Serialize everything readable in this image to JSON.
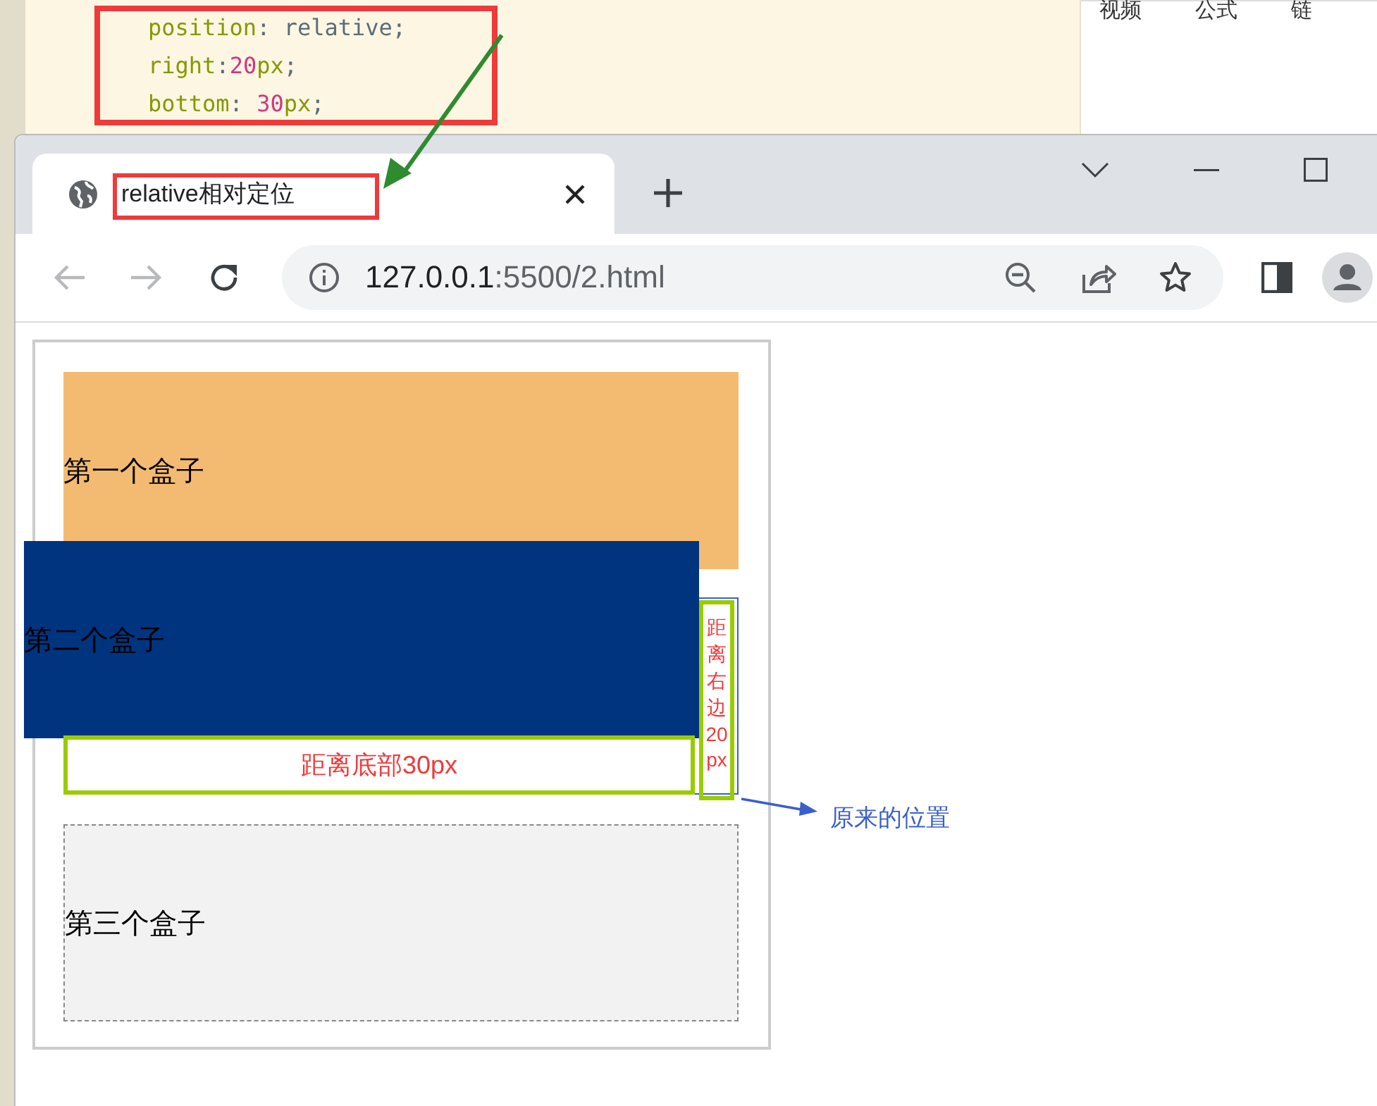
{
  "editor": {
    "code_lines": [
      [
        {
          "text": "position",
          "kind": "property"
        },
        {
          "text": ": ",
          "kind": "punct"
        },
        {
          "text": "relative",
          "kind": "value"
        },
        {
          "text": ";",
          "kind": "punct"
        }
      ],
      [
        {
          "text": "right",
          "kind": "property"
        },
        {
          "text": ":",
          "kind": "punct"
        },
        {
          "text": "20",
          "kind": "number"
        },
        {
          "text": "px",
          "kind": "unit"
        },
        {
          "text": ";",
          "kind": "punct"
        }
      ],
      [
        {
          "text": "bottom",
          "kind": "property"
        },
        {
          "text": ": ",
          "kind": "punct"
        },
        {
          "text": "30",
          "kind": "number"
        },
        {
          "text": "px",
          "kind": "unit"
        },
        {
          "text": ";",
          "kind": "punct"
        }
      ]
    ]
  },
  "side_panel": {
    "tabs": [
      "视频",
      "公式",
      "链"
    ]
  },
  "browser": {
    "tab": {
      "title": "relative相对定位",
      "selected": true
    },
    "address": {
      "host": "127.0.0.1",
      "path": ":5500/2.html"
    }
  },
  "page": {
    "boxes": [
      {
        "label": "第一个盒子",
        "kind": "plain"
      },
      {
        "label": "第二个盒子",
        "kind": "offset"
      },
      {
        "label": "第三个盒子",
        "kind": "dashed"
      }
    ]
  },
  "annotations": {
    "bottom_label": "距离底部30px",
    "right_label": "距离右边20px",
    "original_position_label": "原来的位置"
  }
}
